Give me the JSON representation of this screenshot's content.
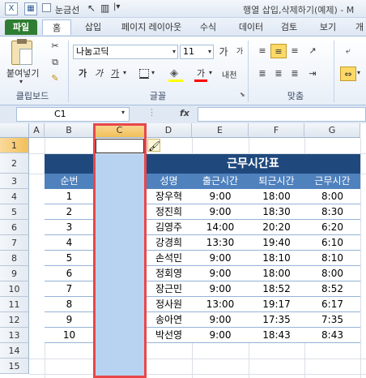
{
  "window": {
    "title": "행열 삽입,삭제하기(예제) - M",
    "quick_access": {
      "gridlines_label": "눈금선"
    }
  },
  "ribbon": {
    "tabs": [
      {
        "label": "파일",
        "active": false
      },
      {
        "label": "홈",
        "active": true
      },
      {
        "label": "삽입",
        "active": false
      },
      {
        "label": "페이지 레이아웃",
        "active": false
      },
      {
        "label": "수식",
        "active": false
      },
      {
        "label": "데이터",
        "active": false
      },
      {
        "label": "검토",
        "active": false
      },
      {
        "label": "보기",
        "active": false
      },
      {
        "label": "개",
        "active": false
      }
    ],
    "clipboard": {
      "paste_label": "붙여넣기",
      "group_label": "클립보드"
    },
    "font": {
      "font_name": "나눔고딕",
      "font_size": "11",
      "group_label": "글꼴",
      "bold": "가",
      "italic": "가",
      "underline": "가",
      "grow": "가",
      "shrink": "가",
      "phonetic": "내천",
      "font_color_glyph": "가"
    },
    "alignment": {
      "group_label": "맞춤"
    }
  },
  "formula_bar": {
    "name_box": "C1",
    "fx": "fx",
    "formula": ""
  },
  "sheet": {
    "columns": [
      "A",
      "B",
      "C",
      "D",
      "E",
      "F",
      "G"
    ],
    "rows": [
      "1",
      "2",
      "3",
      "4",
      "5",
      "6",
      "7",
      "8",
      "9",
      "10",
      "11",
      "12",
      "13",
      "14",
      "15"
    ],
    "selected_column": "C",
    "active_cell": "C1"
  },
  "table": {
    "title": "근무시간표",
    "headers": [
      "순번",
      "성명",
      "출근시간",
      "퇴근시간",
      "근무시간"
    ],
    "rows": [
      [
        "1",
        "장우혁",
        "9:00",
        "18:00",
        "8:00"
      ],
      [
        "2",
        "정진희",
        "9:00",
        "18:30",
        "8:30"
      ],
      [
        "3",
        "김영주",
        "14:00",
        "20:20",
        "6:20"
      ],
      [
        "4",
        "강경희",
        "13:30",
        "19:40",
        "6:10"
      ],
      [
        "5",
        "손석민",
        "9:00",
        "18:10",
        "8:10"
      ],
      [
        "6",
        "정회영",
        "9:00",
        "18:00",
        "8:00"
      ],
      [
        "7",
        "장근민",
        "9:00",
        "18:52",
        "8:52"
      ],
      [
        "8",
        "정사원",
        "13:00",
        "19:17",
        "6:17"
      ],
      [
        "9",
        "송아연",
        "9:00",
        "17:35",
        "7:35"
      ],
      [
        "10",
        "박선영",
        "9:00",
        "18:43",
        "8:43"
      ]
    ]
  },
  "colors": {
    "title_band": "#1f497d",
    "header_band": "#4f81bd",
    "selection_fill": "#b8d3f1",
    "selection_border": "#e8474a",
    "file_tab": "#2f7d32"
  }
}
